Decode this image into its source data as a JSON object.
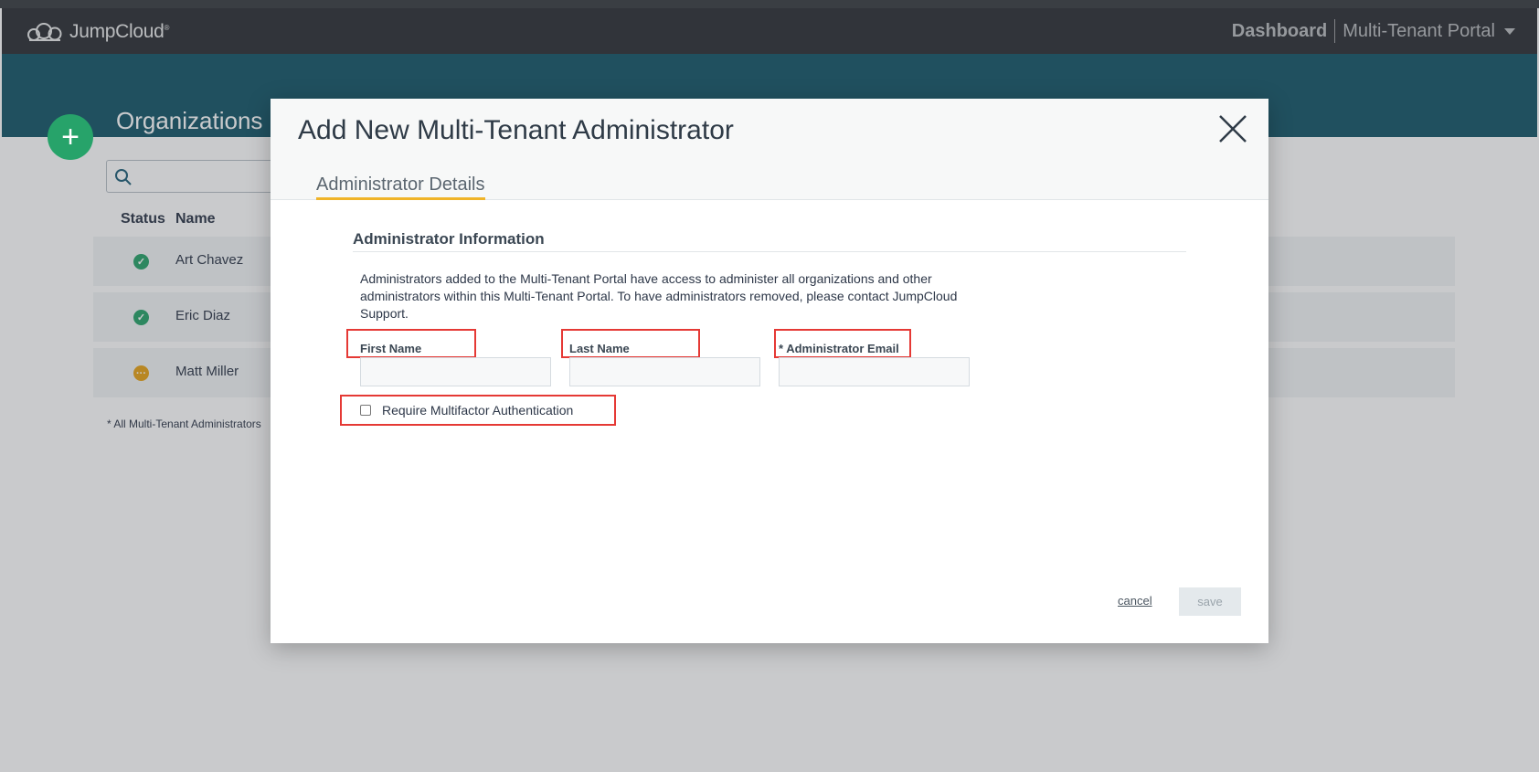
{
  "header": {
    "logo_text": "JumpCloud",
    "logo_mark": "®",
    "dashboard_label": "Dashboard",
    "portal_label": "Multi-Tenant Portal"
  },
  "page": {
    "title": "Organizations",
    "search": {
      "placeholder": ""
    },
    "columns": {
      "status": "Status",
      "name": "Name"
    },
    "rows": [
      {
        "name": "Art Chavez",
        "status": "active",
        "status_color": "#27a36a",
        "status_glyph": "✓"
      },
      {
        "name": "Eric Diaz",
        "status": "active",
        "status_color": "#27a36a",
        "status_glyph": "✓"
      },
      {
        "name": "Matt Miller",
        "status": "pending",
        "status_color": "#e8a317",
        "status_glyph": "···"
      }
    ],
    "footnote": "* All Multi-Tenant Administrators"
  },
  "modal": {
    "title": "Add New Multi-Tenant Administrator",
    "tab_label": "Administrator Details",
    "section_title": "Administrator Information",
    "description": "Administrators added to the Multi-Tenant Portal have access to administer all organizations and other administrators within this Multi-Tenant Portal. To have administrators removed, please contact JumpCloud Support.",
    "fields": {
      "first_name": {
        "label": "First Name",
        "value": ""
      },
      "last_name": {
        "label": "Last Name",
        "value": ""
      },
      "email": {
        "label": "* Administrator Email",
        "value": ""
      }
    },
    "mfa_label": "Require Multifactor Authentication",
    "mfa_checked": false,
    "cancel_label": "cancel",
    "save_label": "save"
  },
  "colors": {
    "accent_teal": "#155668",
    "accent_green": "#27a36a",
    "tab_underline": "#f0b429",
    "highlight_red": "#e53935"
  }
}
